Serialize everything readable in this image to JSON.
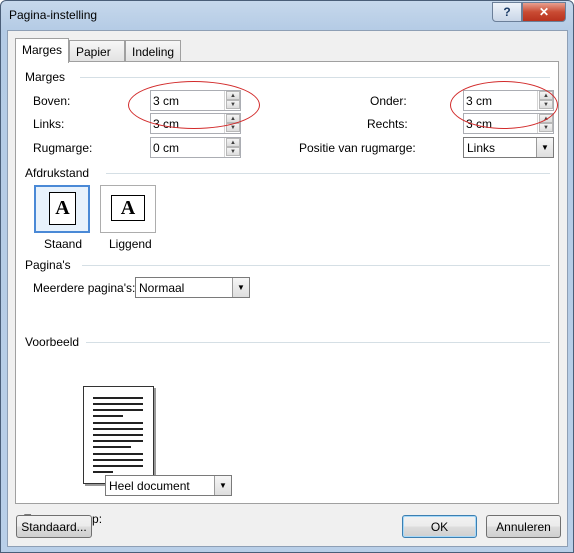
{
  "window": {
    "title": "Pagina-instelling",
    "help_label": "?",
    "close_label": "✕"
  },
  "tabs": [
    {
      "label": "Marges",
      "active": true
    },
    {
      "label": "Papier",
      "active": false
    },
    {
      "label": "Indeling",
      "active": false
    }
  ],
  "margins": {
    "section_title": "Marges",
    "top": {
      "label": "Boven:",
      "value": "3 cm"
    },
    "bottom": {
      "label": "Onder:",
      "value": "3 cm"
    },
    "left": {
      "label": "Links:",
      "value": "3 cm"
    },
    "right": {
      "label": "Rechts:",
      "value": "3 cm"
    },
    "gutter": {
      "label": "Rugmarge:",
      "value": "0 cm"
    },
    "gutter_position": {
      "label": "Positie van rugmarge:",
      "value": "Links"
    }
  },
  "orientation": {
    "section_title": "Afdrukstand",
    "portrait_label": "Staand",
    "landscape_label": "Liggend",
    "icon_letter": "A",
    "selected": "portrait"
  },
  "pages": {
    "section_title": "Pagina's",
    "multiple_label": "Meerdere pagina's:",
    "multiple_value": "Normaal"
  },
  "preview": {
    "section_title": "Voorbeeld",
    "apply_label": "Toepassen op:",
    "apply_value": "Heel document"
  },
  "buttons": {
    "default": "Standaard...",
    "ok": "OK",
    "cancel": "Annuleren"
  },
  "colors": {
    "annotation_circle": "#d22b2b",
    "selection": "#4a89d6"
  }
}
